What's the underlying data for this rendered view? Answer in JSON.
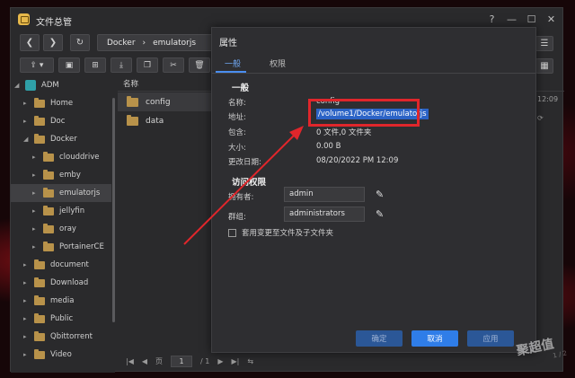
{
  "window": {
    "title": "文件总管"
  },
  "nav": {
    "back": "❮",
    "forward": "❯",
    "refresh": "↻"
  },
  "breadcrumb": [
    "Docker",
    "emulatorjs"
  ],
  "tree": {
    "root": "ADM",
    "items": [
      {
        "label": "Home"
      },
      {
        "label": "Doc"
      },
      {
        "label": "Docker"
      },
      {
        "label": "clouddrive"
      },
      {
        "label": "emby"
      },
      {
        "label": "emulatorjs"
      },
      {
        "label": "jellyfin"
      },
      {
        "label": "oray"
      },
      {
        "label": "PortainerCE"
      },
      {
        "label": "document"
      },
      {
        "label": "Download"
      },
      {
        "label": "media"
      },
      {
        "label": "Public"
      },
      {
        "label": "Qbittorrent"
      },
      {
        "label": "Video"
      }
    ]
  },
  "list": {
    "header": "名称",
    "files": [
      "config",
      "data"
    ],
    "right_time": "12:09"
  },
  "pager": {
    "page_label": "页",
    "page": "1",
    "total": "/ 1"
  },
  "dialog": {
    "title": "属性",
    "tabs": [
      "一般",
      "权限"
    ],
    "general_title": "一般",
    "fields": [
      {
        "label": "名称:",
        "value": "config"
      },
      {
        "label": "地址:",
        "value": "/volume1/Docker/emulatorjs"
      },
      {
        "label": "包含:",
        "value": "0 文件,0 文件夹"
      },
      {
        "label": "大小:",
        "value": "0.00 B"
      },
      {
        "label": "更改日期:",
        "value": "08/20/2022 PM 12:09"
      }
    ],
    "access_title": "访问权限",
    "owner_label": "拥有者:",
    "owner_value": "admin",
    "group_label": "群组:",
    "group_value": "administrators",
    "apply_sub": "套用变更至文件及子文件夹",
    "btn_ok": "确定",
    "btn_cancel": "取消",
    "btn_apply": "应用"
  },
  "watermark": {
    "main": "聚超值",
    "sub": "1 / 2"
  },
  "colors": {
    "accent": "#2f7de8",
    "highlight": "#e0262b"
  }
}
